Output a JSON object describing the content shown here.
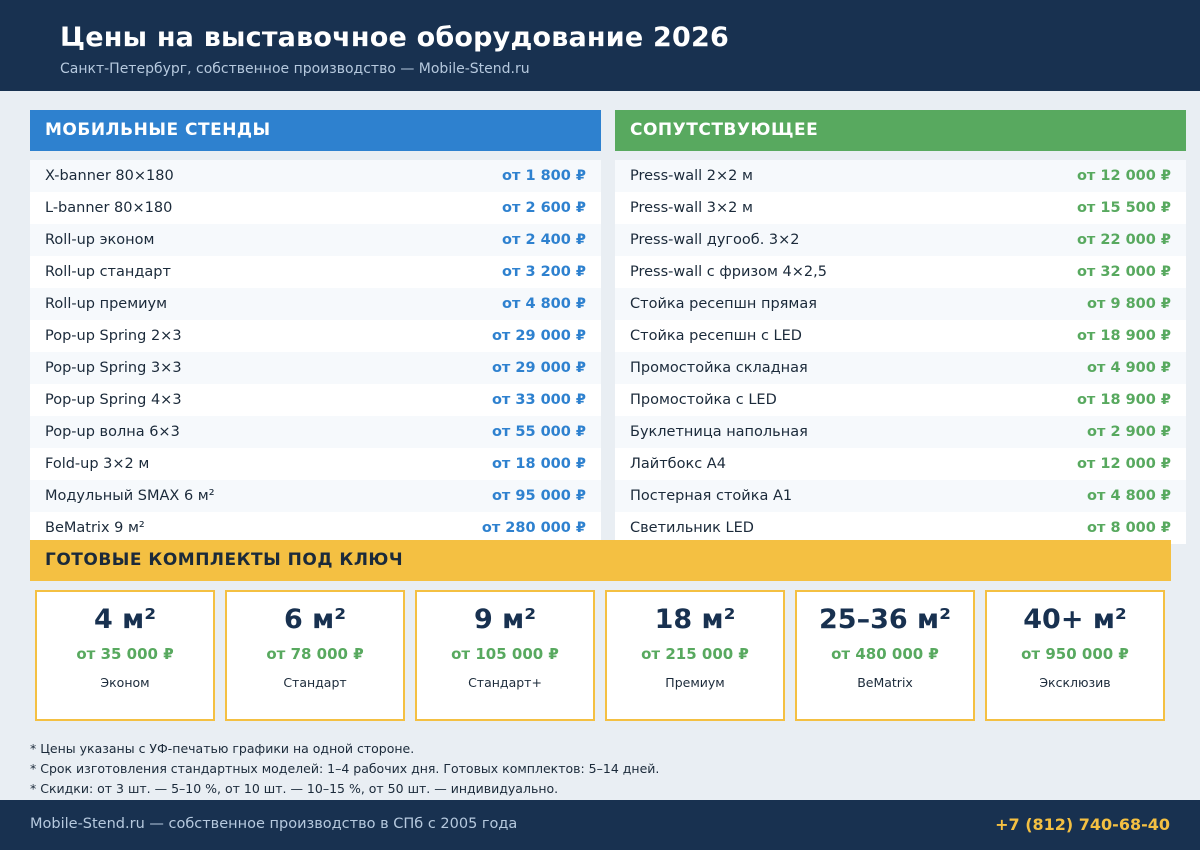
{
  "header": {
    "title": "Цены на выставочное оборудование 2026",
    "subtitle": "Санкт-Петербург, собственное производство — Mobile-Stend.ru"
  },
  "mobile": {
    "title": "МОБИЛЬНЫЕ СТЕНДЫ",
    "items": [
      {
        "name": "X-banner 80×180",
        "price": "от 1 800 ₽"
      },
      {
        "name": "L-banner 80×180",
        "price": "от 2 600 ₽"
      },
      {
        "name": "Roll-up эконом",
        "price": "от 2 400 ₽"
      },
      {
        "name": "Roll-up стандарт",
        "price": "от 3 200 ₽"
      },
      {
        "name": "Roll-up премиум",
        "price": "от 4 800 ₽"
      },
      {
        "name": "Pop-up Spring 2×3",
        "price": "от 29 000 ₽"
      },
      {
        "name": "Pop-up Spring 3×3",
        "price": "от 29 000 ₽"
      },
      {
        "name": "Pop-up Spring 4×3",
        "price": "от 33 000 ₽"
      },
      {
        "name": "Pop-up волна 6×3",
        "price": "от 55 000 ₽"
      },
      {
        "name": "Fold-up 3×2 м",
        "price": "от 18 000 ₽"
      },
      {
        "name": "Модульный SMAX 6 м²",
        "price": "от 95 000 ₽"
      },
      {
        "name": "BeMatrix 9 м²",
        "price": "от 280 000 ₽"
      }
    ]
  },
  "related": {
    "title": "СОПУТСТВУЮЩЕЕ",
    "items": [
      {
        "name": "Press-wall 2×2 м",
        "price": "от 12 000 ₽"
      },
      {
        "name": "Press-wall 3×2 м",
        "price": "от 15 500 ₽"
      },
      {
        "name": "Press-wall дугооб. 3×2",
        "price": "от 22 000 ₽"
      },
      {
        "name": "Press-wall с фризом 4×2,5",
        "price": "от 32 000 ₽"
      },
      {
        "name": "Стойка ресепшн прямая",
        "price": "от 9 800 ₽"
      },
      {
        "name": "Стойка ресепшн с LED",
        "price": "от 18 900 ₽"
      },
      {
        "name": "Промостойка складная",
        "price": "от 4 900 ₽"
      },
      {
        "name": "Промостойка с LED",
        "price": "от 18 900 ₽"
      },
      {
        "name": "Буклетница напольная",
        "price": "от 2 900 ₽"
      },
      {
        "name": "Лайтбокс А4",
        "price": "от 12 000 ₽"
      },
      {
        "name": "Постерная стойка А1",
        "price": "от 4 800 ₽"
      },
      {
        "name": "Светильник LED",
        "price": "от 8 000 ₽"
      }
    ]
  },
  "kits": {
    "title": "ГОТОВЫЕ КОМПЛЕКТЫ ПОД КЛЮЧ",
    "items": [
      {
        "size": "4 м²",
        "price": "от 35 000 ₽",
        "tier": "Эконом"
      },
      {
        "size": "6 м²",
        "price": "от 78 000 ₽",
        "tier": "Стандарт"
      },
      {
        "size": "9 м²",
        "price": "от 105 000 ₽",
        "tier": "Стандарт+"
      },
      {
        "size": "18 м²",
        "price": "от 215 000 ₽",
        "tier": "Премиум"
      },
      {
        "size": "25–36 м²",
        "price": "от 480 000 ₽",
        "tier": "BeMatrix"
      },
      {
        "size": "40+ м²",
        "price": "от 950 000 ₽",
        "tier": "Эксклюзив"
      }
    ]
  },
  "notes": [
    "* Цены указаны с УФ-печатью графики на одной стороне.",
    "* Срок изготовления стандартных моделей: 1–4 рабочих дня. Готовых комплектов: 5–14 дней.",
    "* Скидки: от 3 шт. — 5–10 %, от 10 шт. — 10–15 %, от 50 шт. — индивидуально."
  ],
  "footer": {
    "text": "Mobile-Stend.ru — собственное производство в СПб с 2005 года",
    "phone": "+7 (812) 740-68-40"
  }
}
